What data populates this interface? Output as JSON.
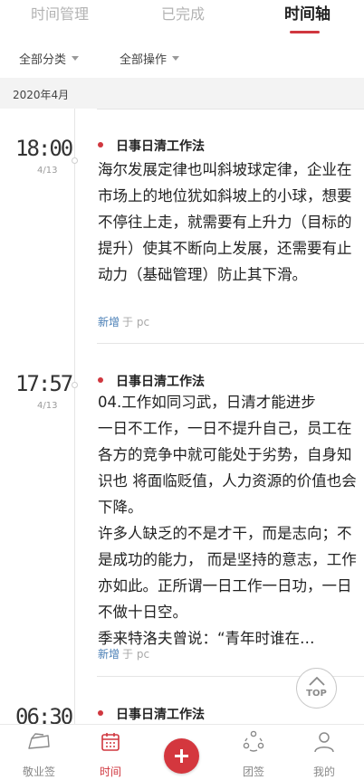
{
  "tabs": [
    {
      "label": "时间管理"
    },
    {
      "label": "已完成"
    },
    {
      "label": "时间轴",
      "active": true
    }
  ],
  "filters": {
    "category": "全部分类",
    "action": "全部操作"
  },
  "month": "2020年4月",
  "entries": [
    {
      "time": "18:00",
      "date": "4/13",
      "title": "日事日清工作法",
      "body": "海尔发展定律也叫斜坡球定律，企业在市场上的地位犹如斜坡上的小球，想要不停往上走，就需要有上升力（目标的提升）使其不断向上发展，还需要有止动力（基础管理）防止其下滑。",
      "action": "新增",
      "source": "于 pc"
    },
    {
      "time": "17:57",
      "date": "4/13",
      "title": "日事日清工作法",
      "body": "04.工作如同习武，日清才能进步\n一日不工作，一日不提升自己，员工在各方的竞争中就可能处于劣势，自身知识也 将面临贬值，人力资源的价值也会下降。\n许多人缺乏的不是才干，而是志向；不是成功的能力， 而是坚持的意志，工作亦如此。正所谓一日工作一日功，一日不做十日空。\n季来特洛夫曾说：“青年时谁在…",
      "action": "新增",
      "source": "于 pc"
    },
    {
      "time": "06:30",
      "title": "日事日清工作法"
    }
  ],
  "top_button": {
    "label": "TOP"
  },
  "nav": [
    {
      "label": "敬业签",
      "icon": "note-icon"
    },
    {
      "label": "时间",
      "icon": "calendar-icon",
      "active": true
    },
    {
      "label": "",
      "icon": "add-icon"
    },
    {
      "label": "团签",
      "icon": "team-icon"
    },
    {
      "label": "我的",
      "icon": "user-icon"
    }
  ],
  "colors": {
    "accent": "#d0373f",
    "link": "#4a7fb6",
    "muted": "#a8a8a8"
  }
}
